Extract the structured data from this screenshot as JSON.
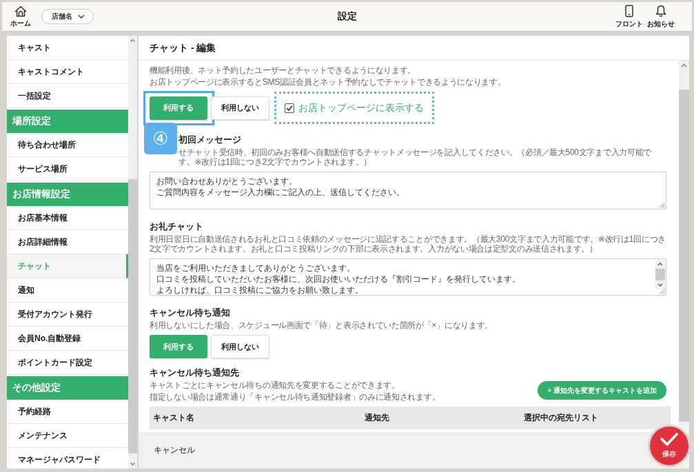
{
  "header": {
    "home": {
      "label": "ホーム"
    },
    "store_select": {
      "value": "店舗名"
    },
    "title": "設定",
    "shortcuts": [
      {
        "kind": "phone",
        "label": "フロント"
      },
      {
        "kind": "bell",
        "label": "お知らせ"
      }
    ]
  },
  "sidebar": {
    "sections": [
      {
        "items": [
          {
            "label": "キャスト",
            "selected": false
          },
          {
            "label": "キャストコメント",
            "selected": false
          },
          {
            "label": "一括設定",
            "selected": false
          }
        ]
      },
      {
        "title": "場所設定",
        "items": [
          {
            "label": "待ち合わせ場所",
            "selected": false
          },
          {
            "label": "サービス場所",
            "selected": false
          }
        ]
      },
      {
        "title": "お店情報設定",
        "items": [
          {
            "label": "お店基本情報",
            "selected": false
          },
          {
            "label": "お店詳細情報",
            "selected": false
          },
          {
            "label": "チャット",
            "selected": true
          },
          {
            "label": "通知",
            "selected": false
          },
          {
            "label": "受付アカウント発行",
            "selected": false
          },
          {
            "label": "会員No.自動登録",
            "selected": false
          },
          {
            "label": "ポイントカード設定",
            "selected": false
          }
        ]
      },
      {
        "title": "その他設定",
        "items": [
          {
            "label": "予約経路",
            "selected": false
          },
          {
            "label": "メンテナンス",
            "selected": false
          },
          {
            "label": "マネージャパスワード",
            "selected": false
          }
        ]
      }
    ]
  },
  "panel": {
    "title": "チャット - 編集",
    "sections": [
      {
        "kind": "toggle",
        "description": [
          "機能利用後、ネット予約したユーザーとチャットできるようになります。",
          "お店トップページに表示するとSMS認証会員とネット予約なしでチャットできるようになります。"
        ],
        "options": [
          {
            "label": "利用する",
            "selected": true,
            "highlighted": true
          },
          {
            "label": "利用しない",
            "selected": false,
            "highlighted": false
          }
        ],
        "checkbox": {
          "label": "お店トップページに表示する",
          "checked": true,
          "highlighted": true
        },
        "step_badge": "④"
      },
      {
        "kind": "textarea",
        "title": "初回メッセージ",
        "description": [
          "せチャット受信時、初回のみお客様へ自動送信するチャットメッセージを記入してください。（必須／最大500文字まで入力可能です。※改行は1回につき2文字でカウントされます。）"
        ],
        "lines": [
          "お問い合わせありがとうございます。",
          "ご質問内容をメッセージ入力欄にご記入の上、送信してください。"
        ],
        "scrollbar": false
      },
      {
        "kind": "textarea",
        "title": "お礼チャット",
        "description": [
          "利用日翌日に自動送信されるお礼と口コミ依頼のメッセージに追記することができます。（最大300文字まで入力可能です。※改行は1回につき2文字でカウントされます。お礼と口コミ投稿リンクの下部に表示されます。入力がない場合は定型文のみ送信されます。）"
        ],
        "lines": [
          "当店をご利用いただきましてありがとうございます。",
          "口コミを投稿していただいたお客様に、次回お使いいただける『割引コード』を発行しています。",
          "よろしければ、口コミ投稿にご協力をお願い致します。"
        ],
        "scrollbar": true
      },
      {
        "kind": "toggle",
        "title": "キャンセル待ち通知",
        "description": [
          "利用しないにした場合、スケジュール画面で「待」と表示されていた箇所が「×」になります。"
        ],
        "options": [
          {
            "label": "利用する",
            "selected": true,
            "highlighted": false
          },
          {
            "label": "利用しない",
            "selected": false,
            "highlighted": false
          }
        ]
      },
      {
        "kind": "table",
        "title": "キャンセル待ち通知先",
        "description": [
          "キャストごとにキャンセル待ちの通知先を変更することができます。",
          "指定しない場合は通常通り「キャンセル待ち通知登録者」のみに通知されます。"
        ],
        "add_button": "+ 通知先を変更するキャストを追加",
        "columns": [
          "キャスト名",
          "通知先",
          "選択中の宛先リスト"
        ]
      }
    ]
  },
  "footer": {
    "cancel": "キャンセル",
    "save": "保存"
  }
}
